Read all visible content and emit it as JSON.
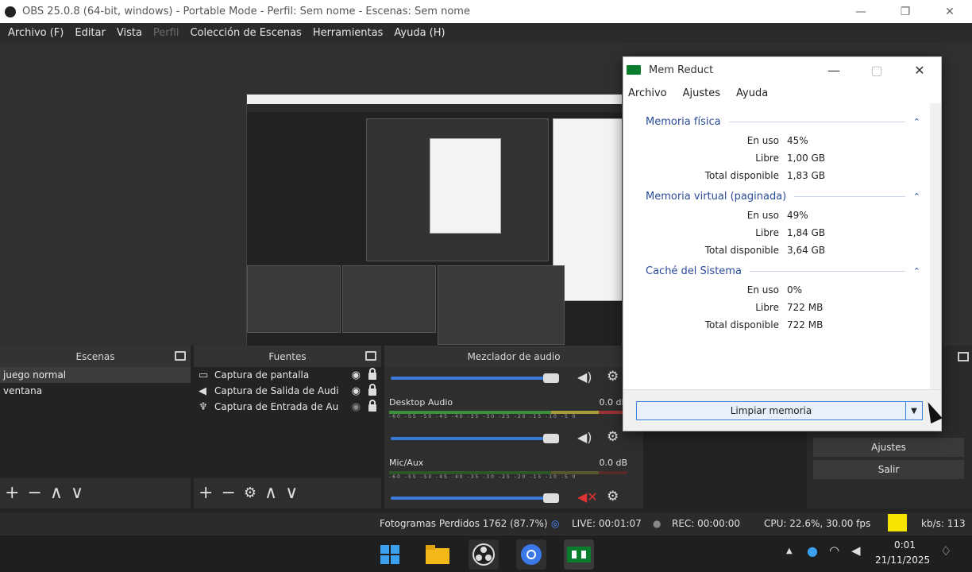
{
  "window": {
    "title": "OBS 25.0.8 (64-bit, windows) - Portable Mode - Perfil: Sem nome - Escenas: Sem nome",
    "minimize": "—",
    "maximize": "❐",
    "close": "✕"
  },
  "menu": {
    "items": [
      "Archivo (F)",
      "Editar",
      "Vista",
      "Perfil",
      "Colección de Escenas",
      "Herramientas",
      "Ayuda (H)"
    ]
  },
  "scenes": {
    "title": "Escenas",
    "items": [
      "juego normal",
      "ventana"
    ],
    "footer": [
      "+",
      "−",
      "∧",
      "∨"
    ]
  },
  "sources": {
    "title": "Fuentes",
    "items": [
      {
        "icon": "monitor-icon",
        "label": "Captura de pantalla"
      },
      {
        "icon": "speaker-icon",
        "label": "Captura de Salida de Audi"
      },
      {
        "icon": "mic-icon",
        "label": "Captura de Entrada de Au"
      }
    ],
    "footer": [
      "+",
      "−",
      "⚙",
      "∧",
      "∨"
    ]
  },
  "mixer": {
    "title": "Mezclador de audio",
    "channels": [
      {
        "name": "",
        "db": "",
        "muted": false
      },
      {
        "name": "Desktop Audio",
        "db": "0.0 dB",
        "muted": false
      },
      {
        "name": "Mic/Aux",
        "db": "0.0 dB",
        "muted": true
      }
    ],
    "ticks": "-60 -55 -50 -45 -40 -35 -30 -25 -20 -15 -10 -5 0"
  },
  "controls": {
    "settings": "Ajustes",
    "exit": "Salir"
  },
  "status": {
    "dropped": "Fotogramas Perdidos 1762 (87.7%)",
    "live": "LIVE: 00:01:07",
    "rec": "REC: 00:00:00",
    "cpu": "CPU: 22.6%, 30.00 fps",
    "kbps": "kb/s: 113",
    "indicator_color": "#f5e400"
  },
  "memreduct": {
    "title": "Mem Reduct",
    "menu": [
      "Archivo",
      "Ajustes",
      "Ayuda"
    ],
    "sections": [
      {
        "title": "Memoria física",
        "rows": [
          {
            "k": "En uso",
            "v": "45%"
          },
          {
            "k": "Libre",
            "v": "1,00 GB"
          },
          {
            "k": "Total disponible",
            "v": "1,83 GB"
          }
        ]
      },
      {
        "title": "Memoria virtual (paginada)",
        "rows": [
          {
            "k": "En uso",
            "v": "49%"
          },
          {
            "k": "Libre",
            "v": "1,84 GB"
          },
          {
            "k": "Total disponible",
            "v": "3,64 GB"
          }
        ]
      },
      {
        "title": "Caché del Sistema",
        "rows": [
          {
            "k": "En uso",
            "v": "0%"
          },
          {
            "k": "Libre",
            "v": "722 MB"
          },
          {
            "k": "Total disponible",
            "v": "722 MB"
          }
        ]
      }
    ],
    "clean_button": "Limpiar memoria"
  },
  "taskbar": {
    "time": "0:01",
    "date": "21/11/2025"
  }
}
